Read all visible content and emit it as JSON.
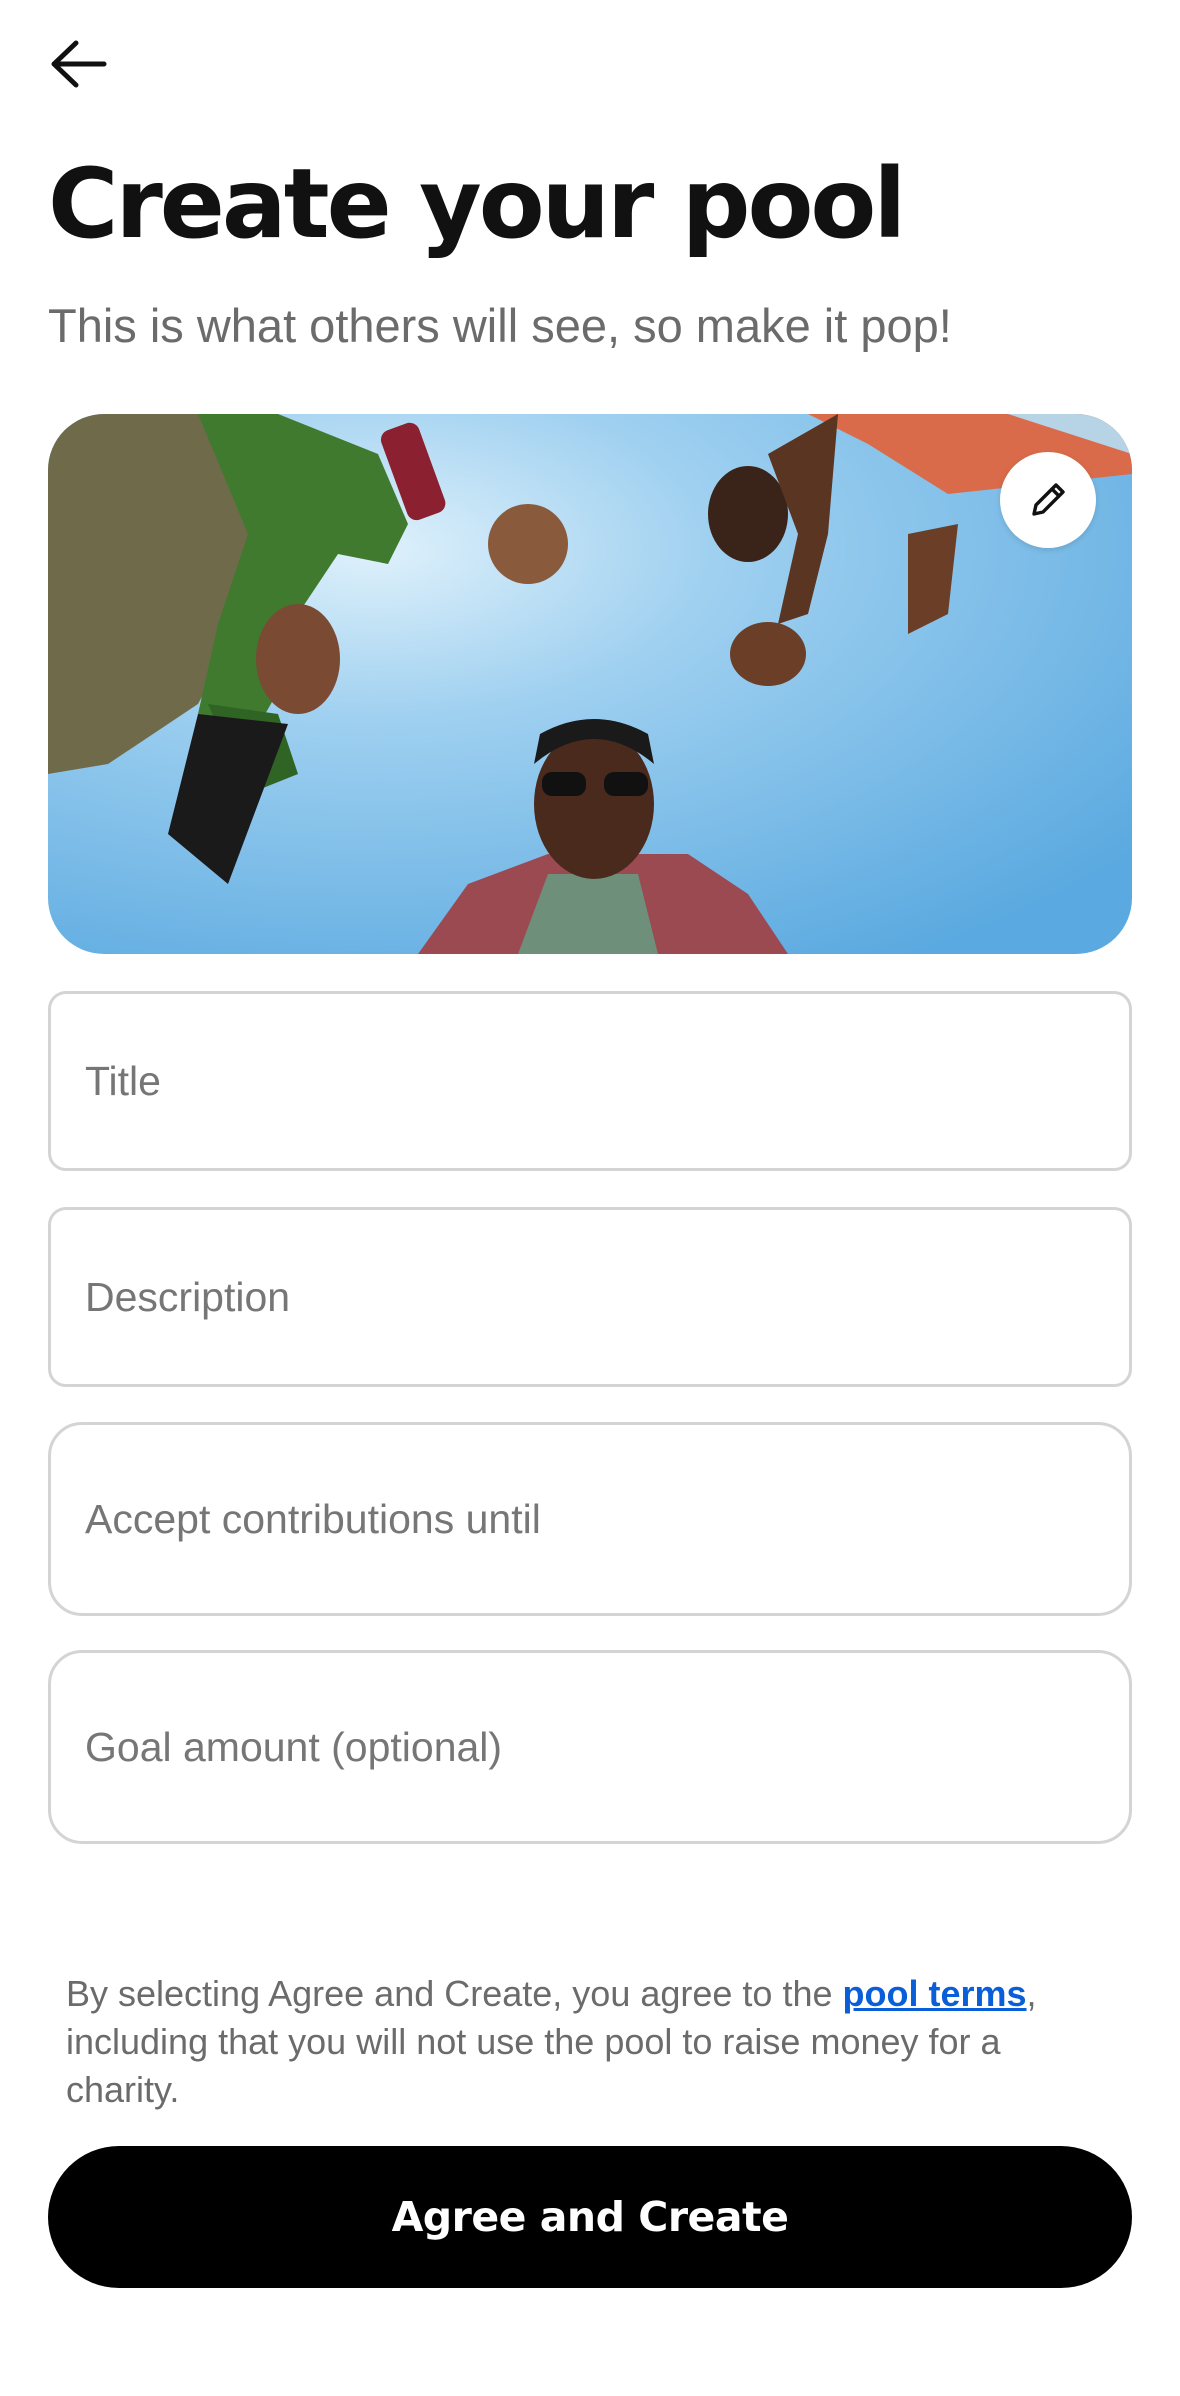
{
  "header": {
    "back_icon": "arrow-left-icon",
    "title": "Create your pool",
    "subtitle": "This is what others will see, so make it pop!"
  },
  "cover": {
    "edit_icon": "pencil-icon",
    "sky_color": "#7fc0ea"
  },
  "form": {
    "title_placeholder": "Title",
    "title_value": "",
    "description_placeholder": "Description",
    "description_value": "",
    "contributions_until_placeholder": "Accept contributions until",
    "contributions_until_value": "",
    "goal_amount_placeholder": "Goal amount (optional)",
    "goal_amount_value": ""
  },
  "terms": {
    "text_before": "By selecting Agree and Create, you agree to the ",
    "link_label": "pool terms",
    "text_after": ", including that you will not use the pool to raise money for a charity."
  },
  "actions": {
    "agree_create_label": "Agree and Create"
  },
  "colors": {
    "link": "#0a5fd8",
    "primary_button": "#000000"
  }
}
